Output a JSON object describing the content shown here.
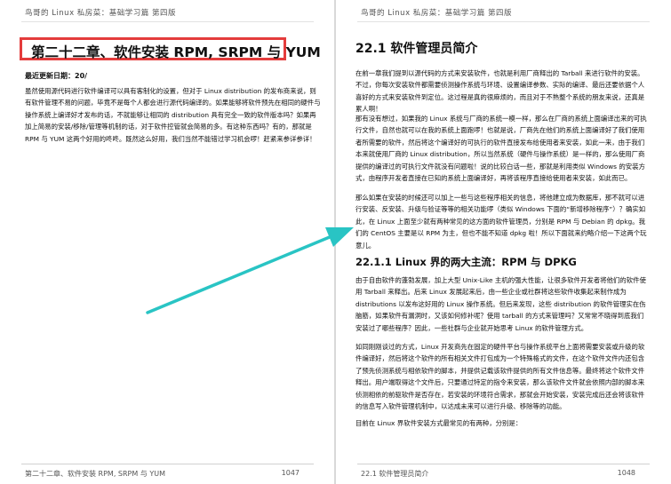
{
  "left_page": {
    "running_head": "鸟哥的 Linux 私房菜：基础学习篇 第四版",
    "chapter_title": "第二十二章、软件安装 RPM, SRPM 与 YUM",
    "update_line": "最近更新日期：20/",
    "intro": "虽然使用源代码进行软件编译可以具有客制化的设置，但对于 Linux distribution 的发布商来说，则有软件管理不易的问题，毕竟不是每个人都会进行源代码编译的。如果能够将软件预先在相同的硬件与操作系统上编译好才发布的话，不就能够让相同的 distribution 具有完全一致的软件版本吗？如果再加上简易的安装/移除/管理等机制的话，对于软件控管就会简易的多。有这种东西吗？有的，那就是 RPM 与 YUM 这两个好用的咚咚。既然这么好用，我们当然不能错过学习机会啰！赶紧来参详参详！",
    "footer_text": "第二十二章、软件安装 RPM, SRPM 与 YUM",
    "page_number": "1047"
  },
  "right_page": {
    "running_head": "鸟哥的 Linux 私房菜：基础学习篇 第四版",
    "section_title": "22.1 软件管理员简介",
    "paragraphs": [
      "在前一章我们提到以源代码的方式来安装软件，也就是利用厂商释出的 Tarball 来进行软件的安装。不过，你每次安装软件都需要侦测操作系统与环境、设置编译参数、实际的编译、最后还要依据个人喜好的方式来安装软件到定位。这过程是真的很麻烦的，而且对于不熟整个系统的朋友来说，还真是累人啊！",
      "那有没有想过，如果我的 Linux 系统与厂商的系统一模一样，那么在厂商的系统上面编译出来的可执行文件，自然也就可以在我的系统上面跑啰！也就是说，厂商先在他们的系统上面编译好了我们使用者所需要的软件，然后将这个编译好的可执行的软件直接发布给使用者来安装，如此一来，由于我们本来就使用厂商的 Linux distribution，所以当然系统（硬件与操作系统）是一样的，那么使用厂商提供的编译过的可执行文件就没有问题啦！说的比较白话一些，那就是利用类似 Windows 的安装方式，由程序开发者直接在已知的系统上面编译好，再将该程序直接给使用者来安装，如此而已。",
      "那么如果在安装的时候还可以加上一些与这些程序相关的信息，将他建立成为数据库，那不就可以进行安装、反安装、升级与验证等等的相关功能啰（类似 Windows 下面的“新增移除程序”）？确实如此，在 Linux 上面至少就有两种常见的这方面的软件管理员，分别是 RPM 与 Debian 的 dpkg。我们的 CentOS 主要是以 RPM 为主，但也不能不知道 dpkg 啦！所以下面就来约略介绍一下这两个玩意儿。"
    ],
    "subsection_title": "22.1.1 Linux 界的两大主流：RPM 与 DPKG",
    "sub_paragraphs": [
      "由于自由软件的蓬勃发展，加上大型 Unix-Like 主机的强大性能，让很多软件开发者将他们的软件使用 Tarball 来释出。后来 Linux 发展起来后，由一些企业或社群将这些软件收集起来制作成为 distributions 以发布这好用的 Linux 操作系统。但后来发现，这些 distribution 的软件管理实在伤脑筋，如果软件有漏洞时，又该如何修补呢？使用 tarball 的方式来管理吗？又常常不晓得到底我们安装过了哪些程序？因此，一些社群与企业就开始思考 Linux 的软件管理方式。",
      "如同刚刚谈过的方式，Linux 开发商先在固定的硬件平台与操作系统平台上面将需要安装或升级的软件编译好，然后将这个软件的所有相关文件打包成为一个特殊格式的文件，在这个软件文件内还包含了预先侦测系统与相依软件的脚本，并提供记载该软件提供的所有文件信息等。最终将这个软件文件释出。用户端取得这个文件后，只要通过特定的指令来安装，那么该软件文件就会依照内部的脚本来侦测相依的前驱软件是否存在，若安装的环境符合需求，那就会开始安装，安装完成后还会将该软件的信息写入软件管理机制中，以达成未来可以进行升级、移除等的功能。",
      "目前在 Linux 界软件安装方式最常见的有两种，分别是："
    ],
    "footer_text": "22.1 软件管理员简介",
    "page_number": "1048"
  },
  "annotations": {
    "highlight_box_color": "#e43c3c",
    "arrow_color": "#29c4c4"
  }
}
